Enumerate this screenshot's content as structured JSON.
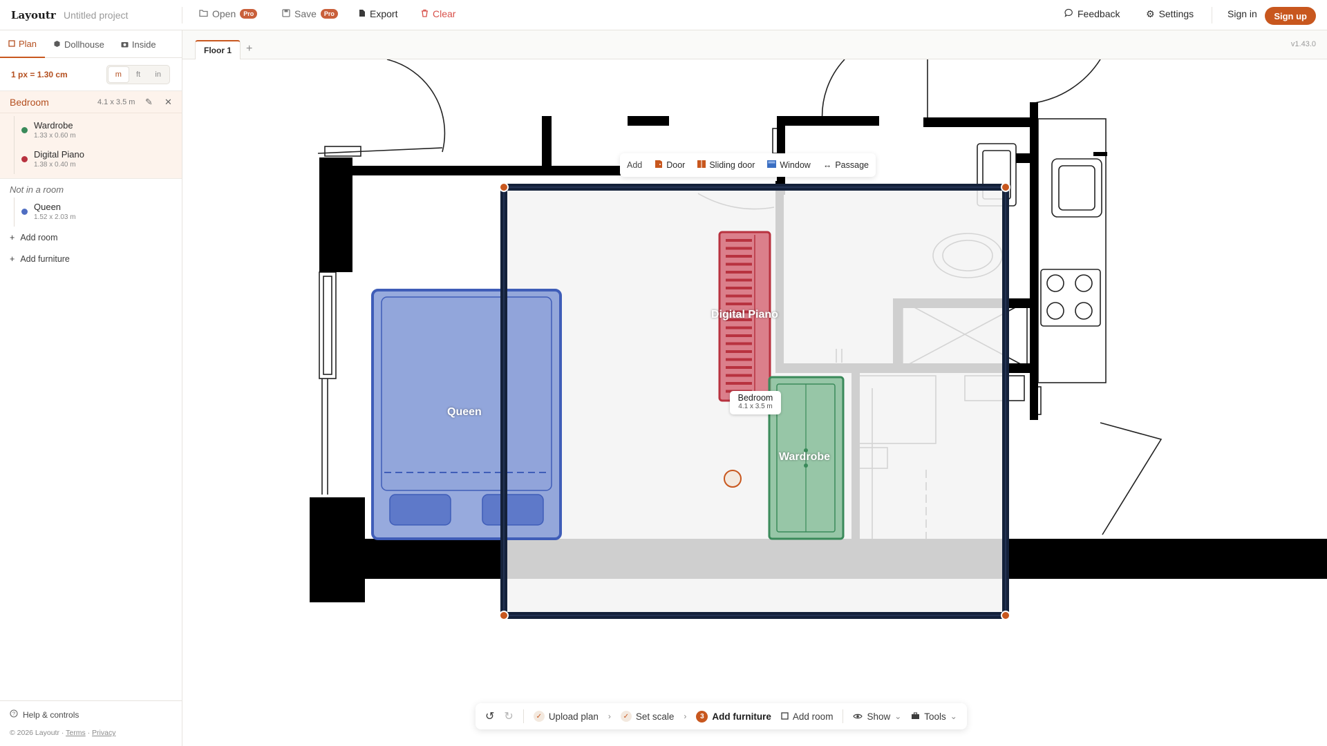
{
  "app": {
    "logo": "Layoutr",
    "project": "Untitled project",
    "version": "v1.43.0"
  },
  "toolbar": {
    "open": "Open",
    "save": "Save",
    "pro": "Pro",
    "export": "Export",
    "clear": "Clear",
    "feedback": "Feedback",
    "settings": "Settings",
    "signin": "Sign in",
    "signup": "Sign up"
  },
  "tabs": [
    {
      "label": "Plan"
    },
    {
      "label": "Dollhouse"
    },
    {
      "label": "Inside"
    }
  ],
  "scale": {
    "text": "1 px = 1.30 cm",
    "units": [
      "m",
      "ft",
      "in"
    ],
    "selected": "m"
  },
  "room": {
    "name": "Bedroom",
    "size": "4.1 x 3.5 m",
    "items": [
      {
        "name": "Wardrobe",
        "size": "1.33 x 0.60 m",
        "color": "#3a8a5a"
      },
      {
        "name": "Digital Piano",
        "size": "1.38 x 0.40 m",
        "color": "#b8323f"
      }
    ]
  },
  "not_in_room": {
    "label": "Not in a room",
    "items": [
      {
        "name": "Queen",
        "size": "1.52 x 2.03 m",
        "color": "#4f6ec2"
      }
    ]
  },
  "actions": {
    "add_room": "Add room",
    "add_furniture": "Add furniture"
  },
  "footer": {
    "help": "Help & controls",
    "copyright": "© 2026 Layoutr ·",
    "terms": "Terms",
    "privacy": "Privacy",
    "dot": "·"
  },
  "floors": [
    {
      "label": "Floor 1"
    }
  ],
  "add_bar": {
    "label": "Add",
    "door": "Door",
    "sliding_door": "Sliding door",
    "window": "Window",
    "passage": "Passage"
  },
  "canvas": {
    "room_tag_name": "Bedroom",
    "room_tag_size": "4.1 x 3.5 m",
    "labels": {
      "queen": "Queen",
      "piano": "Digital Piano",
      "wardrobe": "Wardrobe"
    }
  },
  "bottom_bar": {
    "upload": "Upload plan",
    "scale": "Set scale",
    "step": "3",
    "add_furniture": "Add furniture",
    "add_room": "Add room",
    "show": "Show",
    "tools": "Tools"
  },
  "colors": {
    "accent": "#c8571e",
    "room_outline": "#14213a",
    "queen": "#6f89d0",
    "piano": "#d66a78",
    "wardrobe": "#7cb891"
  }
}
